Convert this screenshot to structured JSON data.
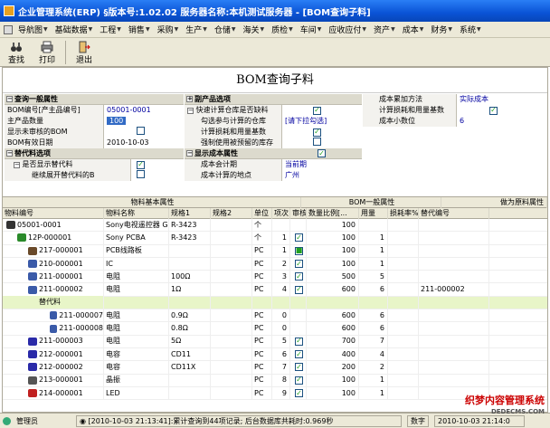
{
  "title": "企业管理系统(ERP) §版本号:1.02.02  服务器名称:本机测试服务器 - [BOM查询子料]",
  "menu": [
    "导航图",
    "基础数据",
    "工程",
    "销售",
    "采购",
    "生产",
    "仓储",
    "海关",
    "质检",
    "车间",
    "应收应付",
    "资产",
    "成本",
    "财务",
    "系统"
  ],
  "toolbar": {
    "search": "查找",
    "print": "打印",
    "exit": "退出"
  },
  "heading": "BOM查询子料",
  "sec1": {
    "title": "查询一般属性",
    "rows": [
      {
        "label": "BOM编号[产主品编号]",
        "value": "05001-0001"
      },
      {
        "label": "主产品数量",
        "value": "100"
      },
      {
        "label": "显示未审核的BOM",
        "value": ""
      },
      {
        "label": "BOM有效日期",
        "value": "2010-10-03"
      }
    ]
  },
  "sec2": {
    "title": "替代料选项",
    "rows": [
      {
        "label": "是否显示替代料",
        "value": ""
      },
      {
        "label": "继续展开替代料的B",
        "value": ""
      }
    ]
  },
  "sec3": {
    "title": "副产品选项",
    "rows": [
      {
        "label": "快速计算仓库是否缺料",
        "value": ""
      },
      {
        "label": "勾选参与计算的仓库",
        "value": "[请下拉勾选]"
      },
      {
        "label": "计算损耗和用量基数",
        "value": ""
      },
      {
        "label": "强制使用被预留的库存",
        "value": ""
      }
    ]
  },
  "sec4": {
    "title": "显示成本属性",
    "rows": [
      {
        "label": "成本会计期",
        "value": "当前期"
      },
      {
        "label": "成本计算的地点",
        "value": "广州"
      }
    ]
  },
  "sec5": {
    "rows": [
      {
        "label": "成本累加方法",
        "value": "实际成本"
      },
      {
        "label": "计算损耗和用量基数",
        "value": ""
      },
      {
        "label": "成本小数位",
        "value": "6"
      }
    ]
  },
  "grid": {
    "groups": [
      "物料基本属性",
      "BOM一般属性",
      "做为原料属性"
    ],
    "columns": [
      "物料编号",
      "物料名称",
      "规格1",
      "规格2",
      "单位",
      "项次",
      "审核",
      "数量比例[...",
      "用量",
      "损耗率%",
      "替代编号"
    ],
    "rows": [
      {
        "code": "05001-0001",
        "name": "Sony电视遥控器 G",
        "s1": "R-3423",
        "s2": "",
        "unit": "个",
        "seq": "",
        "chk": "",
        "ratio": "100",
        "qty": "",
        "loss": "",
        "alt": ""
      },
      {
        "code": "12P-000001",
        "name": "Sony PCBA",
        "s1": "R-3423",
        "s2": "",
        "unit": "个",
        "seq": "1",
        "chk": "✓",
        "ratio": "100",
        "qty": "1",
        "loss": "",
        "alt": ""
      },
      {
        "code": "217-000001",
        "name": "PCB线路板",
        "s1": "",
        "s2": "",
        "unit": "PC",
        "seq": "1",
        "chk": "■",
        "ratio": "100",
        "qty": "1",
        "loss": "",
        "alt": ""
      },
      {
        "code": "210-000001",
        "name": "IC",
        "s1": "",
        "s2": "",
        "unit": "PC",
        "seq": "2",
        "chk": "✓",
        "ratio": "100",
        "qty": "1",
        "loss": "",
        "alt": ""
      },
      {
        "code": "211-000001",
        "name": "电阻",
        "s1": "100Ω",
        "s2": "",
        "unit": "PC",
        "seq": "3",
        "chk": "✓",
        "ratio": "500",
        "qty": "5",
        "loss": "",
        "alt": ""
      },
      {
        "code": "211-000002",
        "name": "电阻",
        "s1": "1Ω",
        "s2": "",
        "unit": "PC",
        "seq": "4",
        "chk": "✓",
        "ratio": "600",
        "qty": "6",
        "loss": "",
        "alt": "211-000002"
      },
      {
        "code": "替代料",
        "name": "",
        "s1": "",
        "s2": "",
        "unit": "",
        "seq": "",
        "chk": "",
        "ratio": "",
        "qty": "",
        "loss": "",
        "alt": ""
      },
      {
        "code": "211-000007",
        "name": "电阻",
        "s1": "0.9Ω",
        "s2": "",
        "unit": "PC",
        "seq": "0",
        "chk": "",
        "ratio": "600",
        "qty": "6",
        "loss": "",
        "alt": ""
      },
      {
        "code": "211-000008",
        "name": "电阻",
        "s1": "0.8Ω",
        "s2": "",
        "unit": "PC",
        "seq": "0",
        "chk": "",
        "ratio": "600",
        "qty": "6",
        "loss": "",
        "alt": ""
      },
      {
        "code": "211-000003",
        "name": "电阻",
        "s1": "5Ω",
        "s2": "",
        "unit": "PC",
        "seq": "5",
        "chk": "✓",
        "ratio": "700",
        "qty": "7",
        "loss": "",
        "alt": ""
      },
      {
        "code": "212-000001",
        "name": "电容",
        "s1": "CD11",
        "s2": "",
        "unit": "PC",
        "seq": "6",
        "chk": "✓",
        "ratio": "400",
        "qty": "4",
        "loss": "",
        "alt": ""
      },
      {
        "code": "212-000002",
        "name": "电容",
        "s1": "CD11X",
        "s2": "",
        "unit": "PC",
        "seq": "7",
        "chk": "✓",
        "ratio": "200",
        "qty": "2",
        "loss": "",
        "alt": ""
      },
      {
        "code": "213-000001",
        "name": "晶振",
        "s1": "",
        "s2": "",
        "unit": "PC",
        "seq": "8",
        "chk": "✓",
        "ratio": "100",
        "qty": "1",
        "loss": "",
        "alt": ""
      },
      {
        "code": "214-000001",
        "name": "LED",
        "s1": "",
        "s2": "",
        "unit": "PC",
        "seq": "9",
        "chk": "✓",
        "ratio": "100",
        "qty": "1",
        "loss": "",
        "alt": ""
      }
    ]
  },
  "status": {
    "user": "管理员",
    "msg": "[2010-10-03 21:13:41]:累计查询到44项记录; 后台数据库共耗时:0.969秒",
    "num": "数字",
    "date": "2010-10-03 21:14:0"
  },
  "watermark": {
    "line1": "织梦内容管理系统",
    "line2": "DEDECMS.COM"
  }
}
